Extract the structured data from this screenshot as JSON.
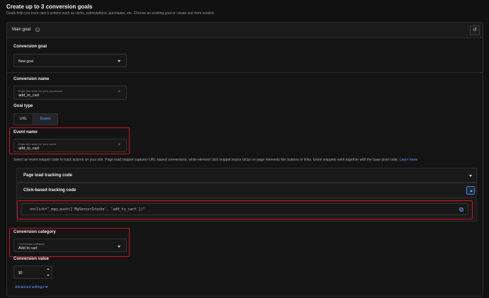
{
  "header": {
    "title": "Create up to 3 conversion goals",
    "subtitle": "Goals help you track user's actions such as clicks, subscriptions, purchases, etc. Choose an existing goal or create one from scratch."
  },
  "card": {
    "title": "Main goal",
    "info_icon": "i",
    "reset_icon": "↺"
  },
  "conversion_goal": {
    "label": "Conversion goal",
    "value": "New goal"
  },
  "conversion_name": {
    "label": "Conversion name",
    "placeholder": "Enter the name for your conversion",
    "value": "add_to_cart",
    "clear": "×"
  },
  "goal_type": {
    "label": "Goal type",
    "options": [
      "URL",
      "Event"
    ],
    "selected": "Event"
  },
  "event_name": {
    "label": "Event name",
    "placeholder": "Enter the name for your event",
    "value": "add_to_cart",
    "clear": "×"
  },
  "snippet": {
    "description": "Select an event snippet code to track actions on your site. Page load snippet captures URL-based conversions, while element click snippet tracks clicks on page elements like buttons or links. Event snippets work together with the base pixel code.",
    "learn_more": "Learn more",
    "page_load_title": "Page load tracking code",
    "click_title": "Click-based tracking code",
    "code": "onclick=\"_mgq.push(['MgSensorInvoke', 'add_to_cart'])\""
  },
  "conversion_category": {
    "label": "Conversion category",
    "placeholder": "Conversion category",
    "value": "Add to cart"
  },
  "conversion_value": {
    "label": "Conversion value",
    "value": "$0"
  },
  "advanced": {
    "label": "Advanced settings"
  },
  "colors": {
    "accent": "#5a9cff",
    "highlight": "#d0121b",
    "background": "#111111"
  }
}
